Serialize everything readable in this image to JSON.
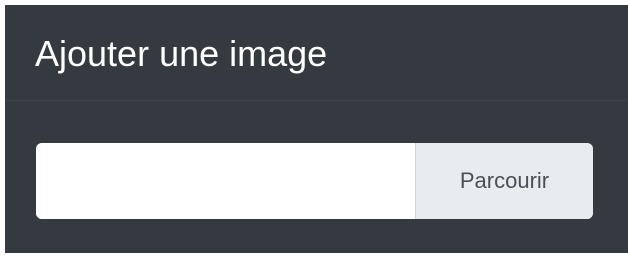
{
  "panel": {
    "title": "Ajouter une image"
  },
  "file_input": {
    "value": "",
    "placeholder": "",
    "browse_label": "Parcourir"
  },
  "colors": {
    "panel_background": "#343a40",
    "title_text": "#ffffff",
    "input_background": "#ffffff",
    "browse_background": "#e9ecef",
    "browse_text": "#495057"
  }
}
